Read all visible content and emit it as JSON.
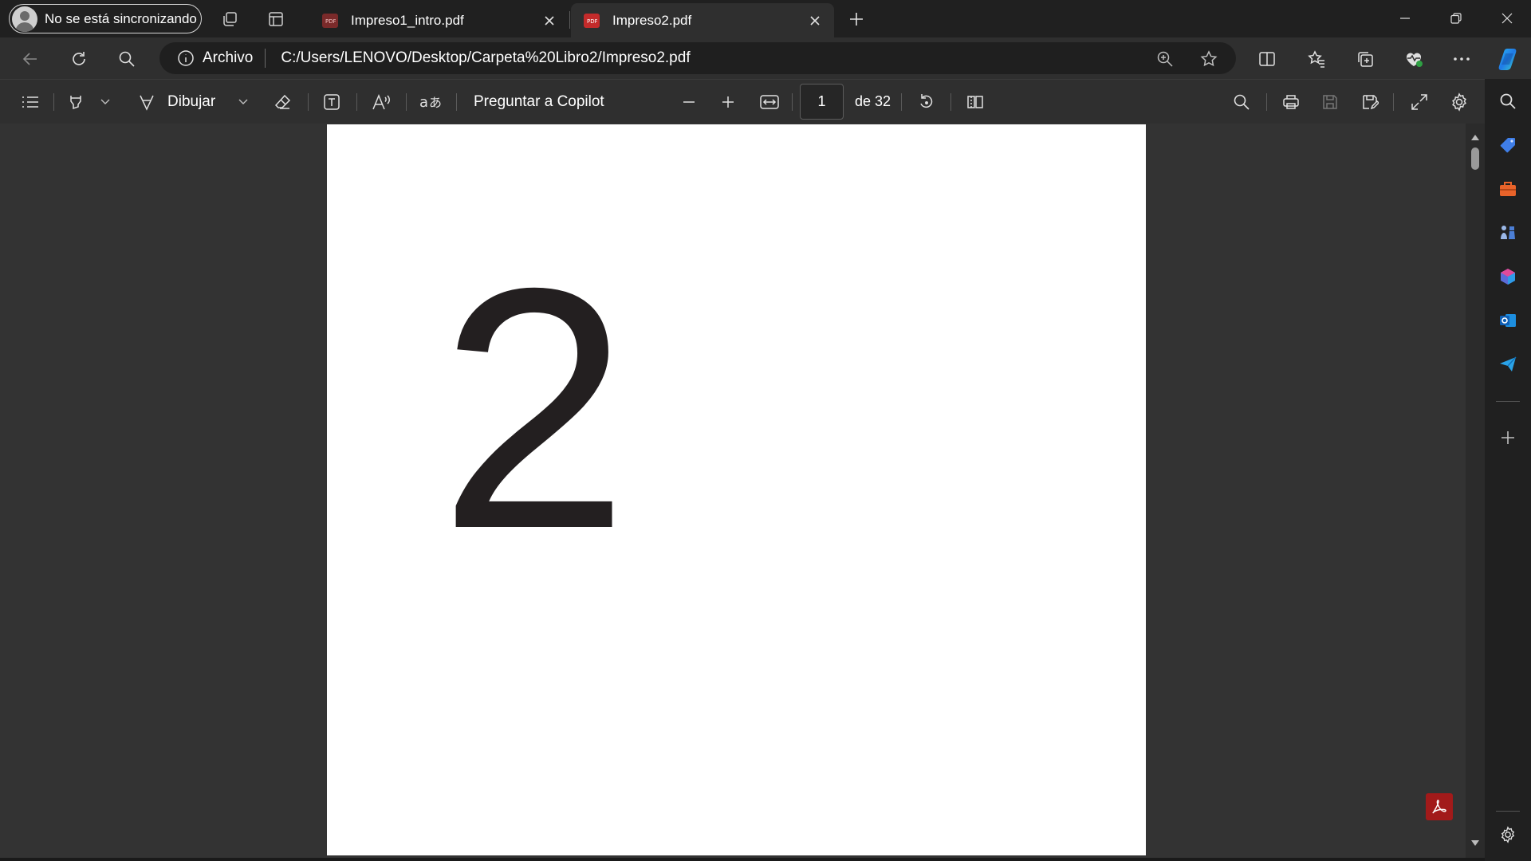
{
  "tabbar": {
    "profile_label": "No se está sincronizando",
    "tabs": [
      {
        "title": "Impreso1_intro.pdf",
        "favicon": "pdf-icon",
        "active": false
      },
      {
        "title": "Impreso2.pdf",
        "favicon": "pdf-icon",
        "active": true
      }
    ]
  },
  "addressbar": {
    "site_label": "Archivo",
    "url": "C:/Users/LENOVO/Desktop/Carpeta%20Libro2/Impreso2.pdf"
  },
  "pdf_toolbar": {
    "draw_label": "Dibujar",
    "copilot_label": "Preguntar a Copilot",
    "page_current": "1",
    "page_total": "de 32"
  },
  "document": {
    "page_number_glyph": "2"
  },
  "colors": {
    "accent_pdf_red": "#a21a1a",
    "tab_active_bg": "#2f2f2f",
    "viewer_bg": "#333333"
  }
}
